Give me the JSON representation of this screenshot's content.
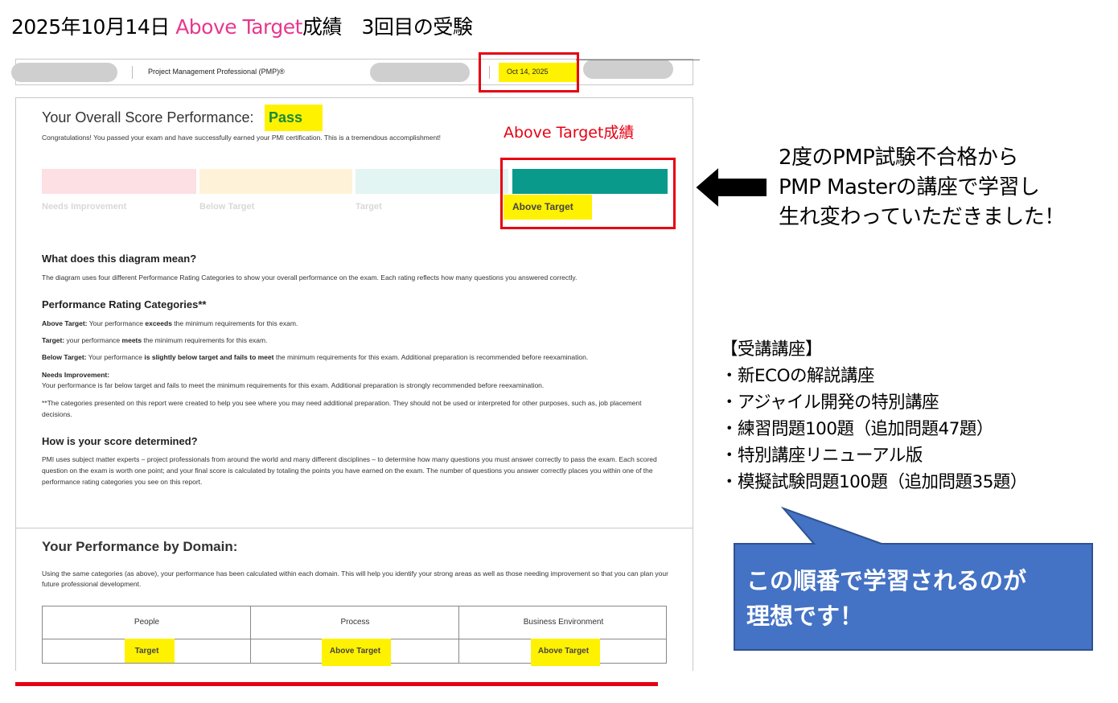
{
  "slide": {
    "title_prefix": "2025年10月14日 ",
    "title_highlight": "Above Target",
    "title_suffix": "成績　3回目の受験",
    "highlight_color": "#e8378e"
  },
  "header": {
    "exam_name": "Project Management Professional (PMP)®",
    "date": "Oct 14, 2025"
  },
  "overall": {
    "label": "Your Overall Score Performance:",
    "result": "Pass",
    "congrats": "Congratulations! You passed your exam and have successfully earned your PMI certification. This is a tremendous accomplishment!",
    "categories": [
      "Needs Improvement",
      "Below Target",
      "Target",
      "Above Target"
    ],
    "achieved_category": "Above Target",
    "annotation": "Above Target成績"
  },
  "diagram": {
    "heading": "What does this diagram mean?",
    "text": "The diagram uses four different Performance Rating Categories to show your overall performance on the exam. Each rating reflects how many questions you answered correctly."
  },
  "categories_section": {
    "heading": "Performance Rating Categories**",
    "above_label": "Above Target:",
    "above_pre": " Your performance ",
    "above_bold": "exceeds",
    "above_post": " the minimum requirements for this exam.",
    "target_label": "Target:",
    "target_pre": " your performance ",
    "target_bold": "meets",
    "target_post": " the minimum requirements for this exam.",
    "below_label": "Below Target:",
    "below_pre": " Your performance ",
    "below_bold": "is slightly below target and fails to meet",
    "below_post": " the minimum requirements for this exam. Additional preparation is recommended before reexamination.",
    "needs_label": "Needs Improvement:",
    "needs_text": "Your performance is far below target and fails to meet the minimum requirements for this exam. Additional preparation is strongly recommended before reexamination.",
    "footnote": "**The categories presented on this report were created to help you see where you may need additional preparation. They should not be used or interpreted for other purposes, such as, job placement decisions."
  },
  "score": {
    "heading": "How is your score determined?",
    "text": "PMI uses subject matter experts – project professionals from around the world and many different disciplines – to determine how many questions you must answer correctly to pass the exam. Each scored question on the exam is worth one point; and your final score is calculated by totaling the points you have earned on the exam. The number of questions you answer correctly places you within one of the performance rating categories you see on this report."
  },
  "domain": {
    "heading": "Your Performance by Domain:",
    "text": "Using the same categories (as above), your performance has been calculated within each domain. This will help you identify your strong areas as well as those needing improvement so that you can plan your future professional development.",
    "columns": [
      "People",
      "Process",
      "Business Environment"
    ],
    "results": [
      "Target",
      "Above Target",
      "Above Target"
    ]
  },
  "message": {
    "line1": "2度のPMP試験不合格から",
    "line2": "PMP Masterの講座で学習し",
    "line3": "生れ変わっていただきました！"
  },
  "courses": {
    "heading": "【受講講座】",
    "items": [
      "・新ECOの解説講座",
      "・アジャイル開発の特別講座",
      "・練習問題100題（追加問題47題）",
      "・特別講座リニューアル版",
      "・模擬試験問題100題（追加問題35題）"
    ]
  },
  "callout": {
    "line1": "この順番で学習されるのが",
    "line2": "理想です！",
    "color": "#4472c4"
  }
}
